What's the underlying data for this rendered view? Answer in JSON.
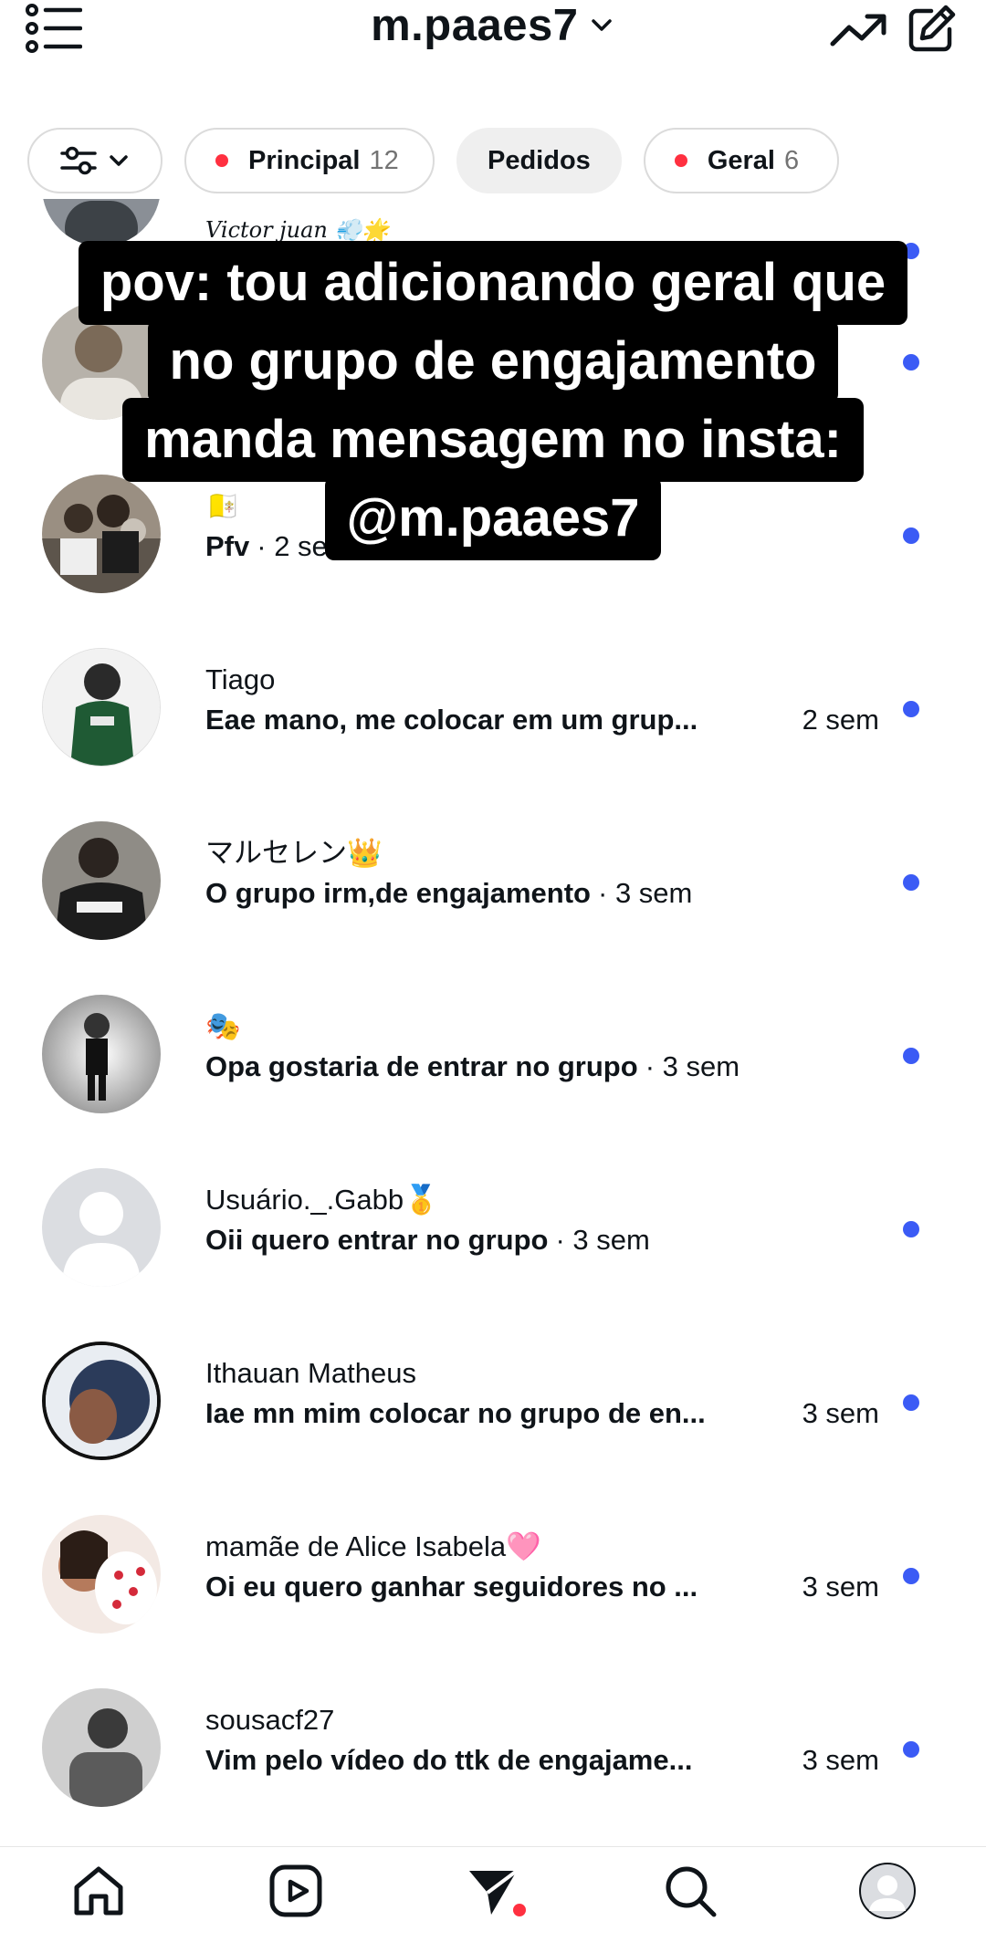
{
  "header": {
    "username": "m.paaes7",
    "menu_icon": "list-menu-icon",
    "trend_icon": "trending-icon",
    "compose_icon": "compose-icon"
  },
  "filters": {
    "filter_icon": "sliders-icon",
    "chips": [
      {
        "label": "Principal",
        "count": "12",
        "dot": true
      },
      {
        "label": "Pedidos",
        "count": "",
        "dot": false
      },
      {
        "label": "Geral",
        "count": "6",
        "dot": true
      }
    ]
  },
  "caption": {
    "lines": [
      "pov: tou adicionando geral que",
      "no grupo de engajamento",
      "manda mensagem no insta:",
      "@m.paaes7"
    ]
  },
  "conversations": [
    {
      "name": "Victor juan 💨🌟",
      "message": "",
      "time": ""
    },
    {
      "name": "",
      "message": "",
      "time": ""
    },
    {
      "name": "🇻🇦",
      "message": "Pfv",
      "time": "2 sem"
    },
    {
      "name": "Tiago",
      "message": "Eae mano, me colocar em um grup...",
      "time": "2 sem"
    },
    {
      "name": "マルセレン👑",
      "message": "O grupo irm,de engajamento",
      "time": "3 sem"
    },
    {
      "name": "🎭",
      "message": "Opa gostaria de entrar no grupo",
      "time": "3 sem"
    },
    {
      "name": "Usuário._.Gabb🥇",
      "message": "Oii quero entrar no grupo",
      "time": "3 sem"
    },
    {
      "name": "Ithauan Matheus",
      "message": "Iae mn mim colocar no grupo de en...",
      "time": "3 sem"
    },
    {
      "name": "mamãe de Alice Isabela🩷",
      "message": "Oi eu quero ganhar seguidores no ...",
      "time": "3 sem"
    },
    {
      "name": "sousacf27",
      "message": "Vim pelo vídeo do ttk de engajame...",
      "time": "3 sem"
    }
  ],
  "separator": " · ",
  "bottom_nav": [
    "home-icon",
    "reels-icon",
    "messages-icon",
    "search-icon",
    "profile-avatar"
  ],
  "colors": {
    "unread": "#3b5bf5",
    "badge": "#ff3040",
    "chip_border": "#dbdbdb"
  }
}
